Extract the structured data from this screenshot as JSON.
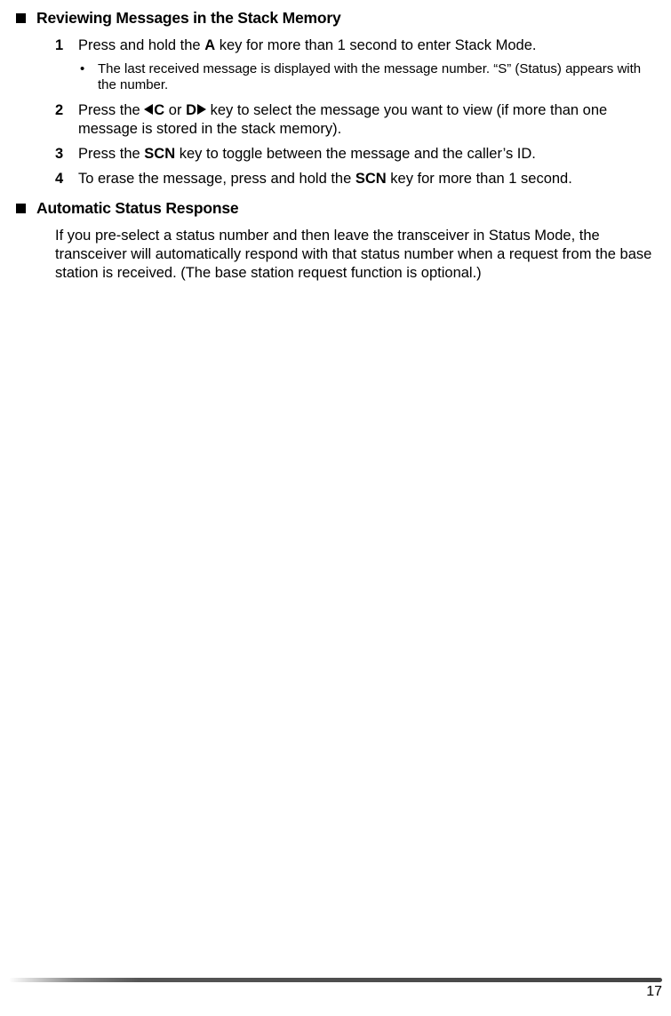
{
  "section1": {
    "heading": "Reviewing Messages in the Stack Memory",
    "step1": {
      "num": "1",
      "text_before": "Press and hold the ",
      "key": "A",
      "text_after": " key for more than 1 second to enter Stack Mode."
    },
    "sub1": {
      "text": "The last received message is displayed with the message number.  “S” (Status) appears with the number."
    },
    "step2": {
      "num": "2",
      "text_a": "Press the ",
      "key_c": "C",
      "text_or": " or ",
      "key_d": "D",
      "text_b": " key to select the message you want to view (if more than one message is stored in the stack memory)."
    },
    "step3": {
      "num": "3",
      "text_a": "Press the ",
      "key": "SCN",
      "text_b": " key to toggle between the message and the caller’s ID."
    },
    "step4": {
      "num": "4",
      "text_a": "To erase the message, press and hold the ",
      "key": "SCN",
      "text_b": " key for more than 1 second."
    }
  },
  "section2": {
    "heading": "Automatic Status Response",
    "para": "If you pre-select a status number and then leave the transceiver in Status Mode, the transceiver will automatically respond with that status number when a request from the base station is received.  (The base station request function is optional.)"
  },
  "page": "17"
}
